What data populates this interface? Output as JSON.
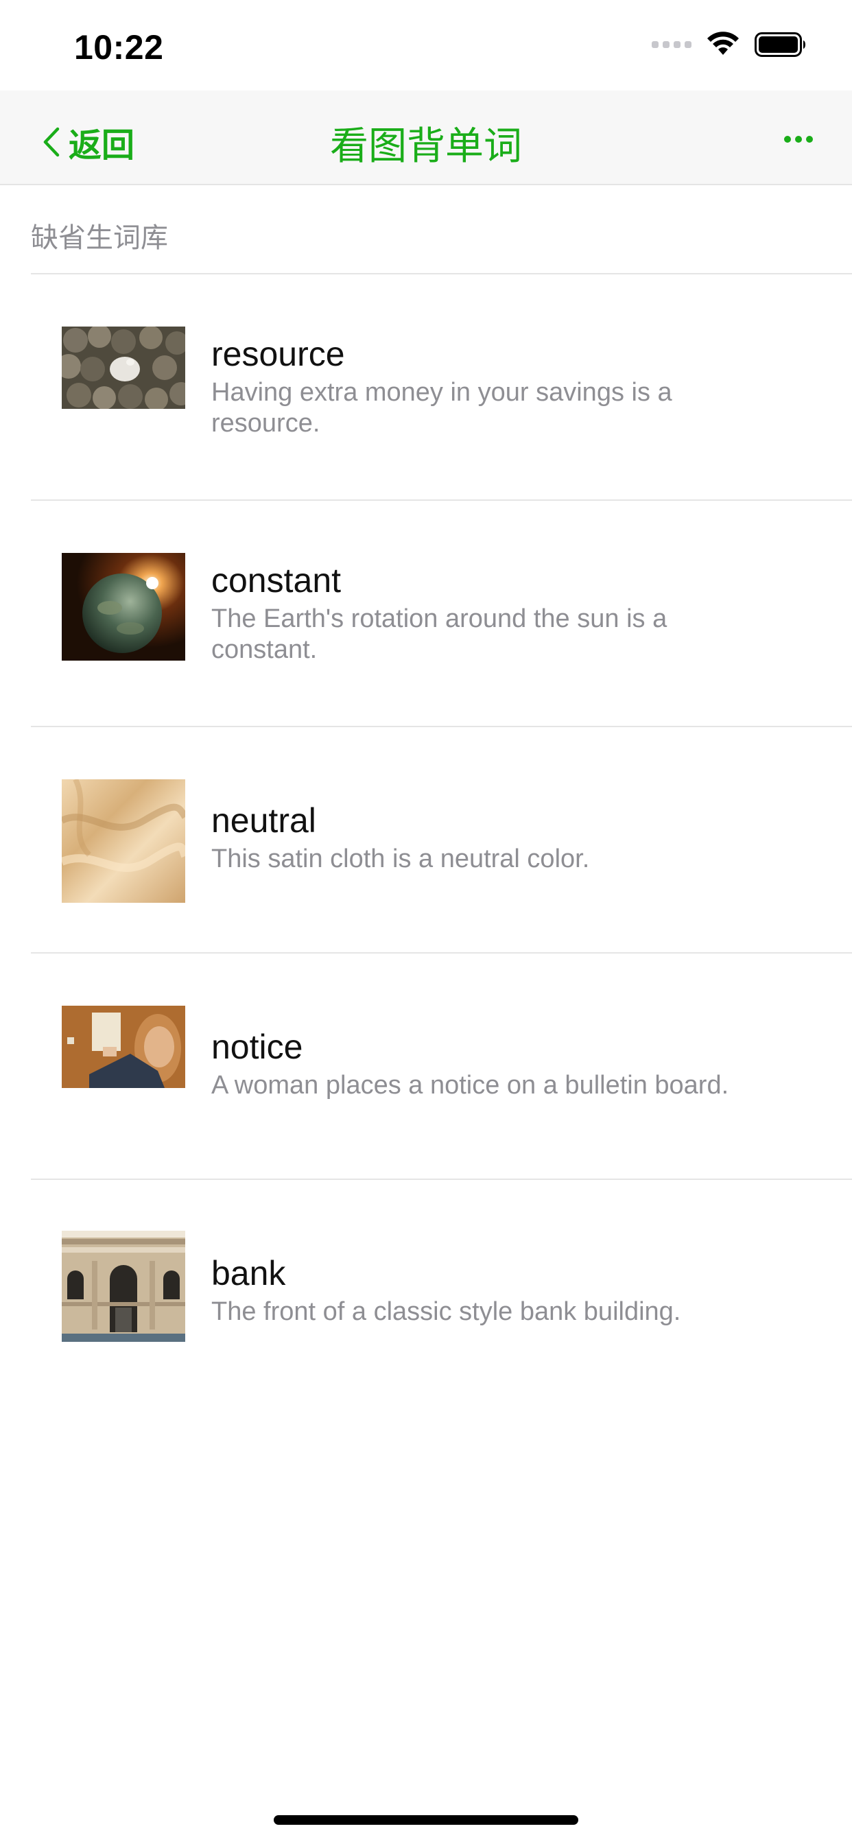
{
  "status_bar": {
    "time": "10:22"
  },
  "nav": {
    "back_label": "返回",
    "title": "看图背单词",
    "accent_color": "#1aad19"
  },
  "section": {
    "title": "缺省生词库"
  },
  "words": [
    {
      "word": "resource",
      "sentence": "Having extra money in your savings is a resource.",
      "thumbnail": "coins-piggy-bank"
    },
    {
      "word": "constant",
      "sentence": "The Earth's rotation around the sun is a constant.",
      "thumbnail": "earth-sun"
    },
    {
      "word": "neutral",
      "sentence": "This satin cloth is a neutral color.",
      "thumbnail": "satin-cloth"
    },
    {
      "word": "notice",
      "sentence": "A woman places a notice on a bulletin board.",
      "thumbnail": "woman-bulletin-board"
    },
    {
      "word": "bank",
      "sentence": "The front of a classic style bank building.",
      "thumbnail": "bank-building"
    }
  ]
}
